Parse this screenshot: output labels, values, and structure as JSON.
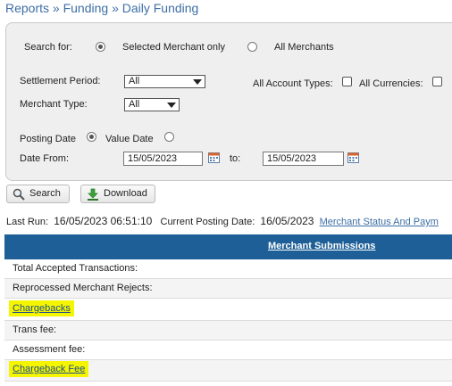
{
  "breadcrumb": {
    "text": "Reports » Funding » Daily Funding"
  },
  "filters": {
    "search_for_label": "Search for:",
    "selected_merchant_label": "Selected Merchant only",
    "all_merchants_label": "All Merchants",
    "settlement_period_label": "Settlement Period:",
    "settlement_period_value": "All",
    "all_account_types_label": "All Account Types:",
    "all_currencies_label": "All Currencies:",
    "merchant_type_label": "Merchant Type:",
    "merchant_type_value": "All",
    "posting_date_label": "Posting Date",
    "value_date_label": "Value Date",
    "date_from_label": "Date From:",
    "date_from_value": "15/05/2023",
    "to_label": "to:",
    "date_to_value": "15/05/2023"
  },
  "toolbar": {
    "search_label": "Search",
    "download_label": "Download"
  },
  "status": {
    "last_run_label": "Last Run:",
    "last_run_value": "16/05/2023 06:51:10",
    "current_posting_label": "Current Posting Date:",
    "current_posting_value": "16/05/2023",
    "merchant_status_link": "Merchant Status And Paym"
  },
  "table": {
    "header": "Merchant Submissions",
    "rows": [
      {
        "label": "Total Accepted Transactions:"
      },
      {
        "label": "Reprocessed Merchant Rejects:"
      },
      {
        "label": "Chargebacks"
      },
      {
        "label": "Trans fee:"
      },
      {
        "label": "Assessment fee:"
      },
      {
        "label": "Chargeback Fee"
      }
    ]
  },
  "colors": {
    "header_bg": "#1d5f96",
    "link": "#3d6fa5",
    "highlight": "#f5f500"
  }
}
